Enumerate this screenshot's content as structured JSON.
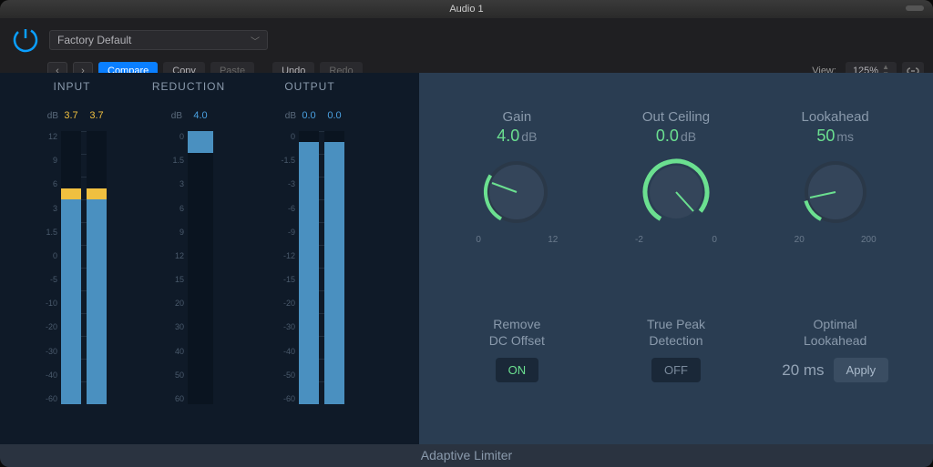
{
  "window": {
    "title": "Audio 1",
    "plugin_name": "Adaptive Limiter"
  },
  "toolbar": {
    "preset": "Factory Default",
    "compare": "Compare",
    "copy": "Copy",
    "paste": "Paste",
    "undo": "Undo",
    "redo": "Redo",
    "view_label": "View:",
    "zoom": "125%"
  },
  "meters": {
    "input": {
      "title": "INPUT",
      "db_label": "dB",
      "left_val": "3.7",
      "right_val": "3.7",
      "scale": [
        "12",
        "9",
        "6",
        "3",
        "1.5",
        "0",
        "-5",
        "-10",
        "-20",
        "-30",
        "-40",
        "-60"
      ],
      "left_fill_top_pct": 23,
      "left_fill_bot_pct": 0,
      "left_cap_top_pct": 21,
      "right_fill_top_pct": 23,
      "right_fill_bot_pct": 0,
      "right_cap_top_pct": 21
    },
    "reduction": {
      "title": "REDUCTION",
      "db_label": "dB",
      "val": "4.0",
      "scale": [
        "0",
        "1.5",
        "3",
        "6",
        "9",
        "12",
        "15",
        "20",
        "30",
        "40",
        "50",
        "60"
      ],
      "fill_top_pct": 0,
      "fill_height_pct": 8
    },
    "output": {
      "title": "OUTPUT",
      "db_label": "dB",
      "left_val": "0.0",
      "right_val": "0.0",
      "scale": [
        "0",
        "-1.5",
        "-3",
        "-6",
        "-9",
        "-12",
        "-15",
        "-20",
        "-30",
        "-40",
        "-50",
        "-60"
      ],
      "fill_top_pct": 4,
      "fill_bot_pct": 0
    }
  },
  "controls": {
    "gain": {
      "label": "Gain",
      "value": "4.0",
      "unit": "dB",
      "min": "0",
      "max": "12",
      "angle": -105
    },
    "ceiling": {
      "label": "Out Ceiling",
      "value": "0.0",
      "unit": "dB",
      "min": "-2",
      "max": "0",
      "angle": 135
    },
    "lookahead": {
      "label": "Lookahead",
      "value": "50",
      "unit": "ms",
      "min": "20",
      "max": "200",
      "angle": -110
    },
    "dc_offset": {
      "label": "Remove\nDC Offset",
      "state": "ON"
    },
    "true_peak": {
      "label": "True Peak\nDetection",
      "state": "OFF"
    },
    "optimal": {
      "label": "Optimal\nLookahead",
      "value": "20 ms",
      "apply": "Apply"
    }
  }
}
